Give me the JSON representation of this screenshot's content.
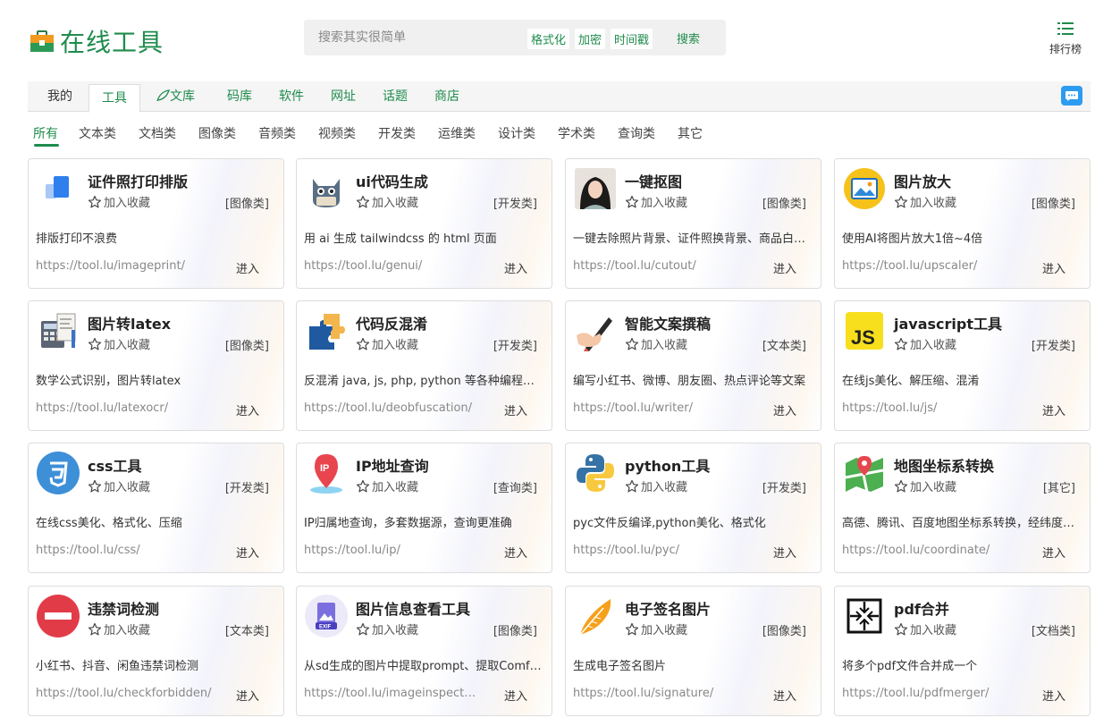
{
  "header": {
    "site_name": "在线工具",
    "search_placeholder": "搜索其实很简单",
    "quick_tags": [
      "格式化",
      "加密",
      "时间戳"
    ],
    "search_button": "搜索",
    "rank_label": "排行榜"
  },
  "nav": {
    "items": [
      "我的",
      "工具",
      "文库",
      "码库",
      "软件",
      "网址",
      "话题",
      "商店"
    ],
    "active": "工具"
  },
  "categories": {
    "items": [
      "所有",
      "文本类",
      "文档类",
      "图像类",
      "音频类",
      "视频类",
      "开发类",
      "运维类",
      "设计类",
      "学术类",
      "查询类",
      "其它"
    ],
    "active": "所有"
  },
  "fav_label": "加入收藏",
  "enter_label": "进入",
  "cards": [
    {
      "title": "证件照打印排版",
      "category": "[图像类]",
      "desc": "排版打印不浪费",
      "url": "https://tool.lu/imageprint/",
      "icon": "layout-icon"
    },
    {
      "title": "ui代码生成",
      "category": "[开发类]",
      "desc": "用 ai 生成 tailwindcss 的 html 页面",
      "url": "https://tool.lu/genui/",
      "icon": "cat-icon"
    },
    {
      "title": "一键抠图",
      "category": "[图像类]",
      "desc": "一键去除照片背景、证件照换背景、商品白…",
      "url": "https://tool.lu/cutout/",
      "icon": "portrait-icon"
    },
    {
      "title": "图片放大",
      "category": "[图像类]",
      "desc": "使用AI将图片放大1倍~4倍",
      "url": "https://tool.lu/upscaler/",
      "icon": "picture-icon"
    },
    {
      "title": "图片转latex",
      "category": "[图像类]",
      "desc": "数学公式识别，图片转latex",
      "url": "https://tool.lu/latexocr/",
      "icon": "calculator-icon"
    },
    {
      "title": "代码反混淆",
      "category": "[开发类]",
      "desc": "反混淆 java, js, php, python 等各种编程…",
      "url": "https://tool.lu/deobfuscation/",
      "icon": "puzzle-icon"
    },
    {
      "title": "智能文案撰稿",
      "category": "[文本类]",
      "desc": "编写小红书、微博、朋友圈、热点评论等文案",
      "url": "https://tool.lu/writer/",
      "icon": "pen-icon"
    },
    {
      "title": "javascript工具",
      "category": "[开发类]",
      "desc": "在线js美化、解压缩、混淆",
      "url": "https://tool.lu/js/",
      "icon": "js-icon"
    },
    {
      "title": "css工具",
      "category": "[开发类]",
      "desc": "在线css美化、格式化、压缩",
      "url": "https://tool.lu/css/",
      "icon": "css-icon"
    },
    {
      "title": "IP地址查询",
      "category": "[查询类]",
      "desc": "IP归属地查询，多套数据源，查询更准确",
      "url": "https://tool.lu/ip/",
      "icon": "location-pin-icon"
    },
    {
      "title": "python工具",
      "category": "[开发类]",
      "desc": "pyc文件反编译,python美化、格式化",
      "url": "https://tool.lu/pyc/",
      "icon": "python-icon"
    },
    {
      "title": "地图坐标系转换",
      "category": "[其它]",
      "desc": "高德、腾讯、百度地图坐标系转换，经纬度…",
      "url": "https://tool.lu/coordinate/",
      "icon": "map-icon"
    },
    {
      "title": "违禁词检测",
      "category": "[文本类]",
      "desc": "小红书、抖音、闲鱼违禁词检测",
      "url": "https://tool.lu/checkforbidden/",
      "icon": "forbidden-icon"
    },
    {
      "title": "图片信息查看工具",
      "category": "[图像类]",
      "desc": "从sd生成的图片中提取prompt、提取Comf…",
      "url": "https://tool.lu/imageinspecto…",
      "icon": "exif-icon"
    },
    {
      "title": "电子签名图片",
      "category": "[图像类]",
      "desc": "生成电子签名图片",
      "url": "https://tool.lu/signature/",
      "icon": "feather-icon"
    },
    {
      "title": "pdf合并",
      "category": "[文档类]",
      "desc": "将多个pdf文件合并成一个",
      "url": "https://tool.lu/pdfmerger/",
      "icon": "merge-icon"
    }
  ]
}
